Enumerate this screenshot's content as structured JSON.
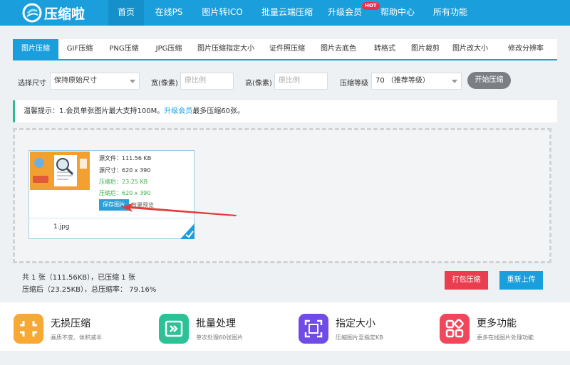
{
  "brand": {
    "name": "压缩啦"
  },
  "nav": {
    "items": [
      {
        "label": "首页"
      },
      {
        "label": "在线PS"
      },
      {
        "label": "图片转ICO"
      },
      {
        "label": "批量云端压缩"
      },
      {
        "label": "升级会员"
      },
      {
        "label": "帮助中心"
      },
      {
        "label": "所有功能"
      }
    ],
    "hot_badge": "HOT"
  },
  "tabs": [
    {
      "label": "图片压缩"
    },
    {
      "label": "GIF压缩"
    },
    {
      "label": "PNG压缩"
    },
    {
      "label": "JPG压缩"
    },
    {
      "label": "图片压缩指定大小"
    },
    {
      "label": "证件照压缩"
    },
    {
      "label": "图片去底色"
    },
    {
      "label": "转格式"
    },
    {
      "label": "图片裁剪"
    },
    {
      "label": "图片改大小"
    },
    {
      "label": "修改分辨率"
    }
  ],
  "options": {
    "size_label": "选择尺寸",
    "size_value": "保持原始尺寸",
    "width_label": "宽(像素)",
    "width_placeholder": "原比例",
    "height_label": "高(像素)",
    "height_placeholder": "原比例",
    "level_label": "压缩等级",
    "level_value": "70 （推荐等级）",
    "start_button": "开始压缩"
  },
  "notice": {
    "prefix": "温馨提示：1.会员单张图片最大支持100M。",
    "link": "升级会员",
    "suffix": "最多压缩60张。"
  },
  "file_card": {
    "source_size": "源文件：111.56 KB",
    "source_dims": "源尺寸：620 x 390",
    "compressed_size": "压缩后：23.25 KB",
    "compressed_dims": "压缩后：620 x 390",
    "save_button": "保存图片",
    "preview": "效果预览",
    "filename": "1.jpg"
  },
  "stats": {
    "line1": "共 1 张（111.56KB），已压缩 1 张",
    "line2": "压缩后（23.25KB），总压缩率： 79.16%"
  },
  "actions": {
    "pack_button": "打包压缩",
    "reupload_button": "重新上传"
  },
  "features": [
    {
      "title": "无损压缩",
      "desc": "画质不变、体积减半",
      "color": "#f7a933",
      "icon": "compress-icon"
    },
    {
      "title": "批量处理",
      "desc": "单次处理60张图片",
      "color": "#2cc197",
      "icon": "batch-icon"
    },
    {
      "title": "指定大小",
      "desc": "压缩图片至指定KB",
      "color": "#6f4ce6",
      "icon": "resize-icon"
    },
    {
      "title": "更多功能",
      "desc": "更多在线图片处理功能",
      "color": "#f0475c",
      "icon": "apps-icon"
    }
  ],
  "colors": {
    "primary": "#1a9fdc",
    "danger": "#ea3d50",
    "success": "#3cae4a"
  }
}
